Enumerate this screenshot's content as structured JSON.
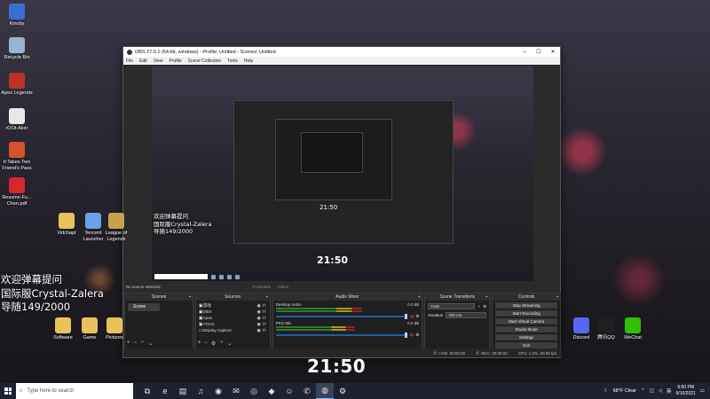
{
  "desktop": {
    "left_icons": [
      {
        "label": "Kinoby",
        "icon": "app-icon",
        "color": "#3a6fd0"
      },
      {
        "label": "Recycle Bin",
        "icon": "recycle-bin-icon",
        "color": "#9ab3cf"
      },
      {
        "label": "Apex Legends",
        "icon": "apex-icon",
        "color": "#c0302a"
      },
      {
        "label": "rOOt-Alotr",
        "icon": "file-icon",
        "color": "#e8e8e8"
      },
      {
        "label": "It Takes Two Friend's Pass",
        "icon": "game-icon",
        "color": "#d4542a"
      },
      {
        "label": "Resume-Fu... Chen.pdf",
        "icon": "pdf-icon",
        "color": "#d8262b"
      }
    ],
    "row_icons": [
      {
        "label": "Vidchapt",
        "icon": "folder-icon",
        "color": "#e8c25a"
      },
      {
        "label": "Tencent Launcher",
        "icon": "tencent-icon",
        "color": "#6aa2e8"
      },
      {
        "label": "League of Legends",
        "icon": "lol-icon",
        "color": "#c9a24a"
      }
    ],
    "bottom_icons": [
      {
        "label": "Software",
        "icon": "folder-icon",
        "color": "#e8c25a"
      },
      {
        "label": "Game",
        "icon": "folder-icon",
        "color": "#e8c25a"
      },
      {
        "label": "Pictures",
        "icon": "folder-icon",
        "color": "#e8c25a"
      }
    ],
    "right_icons": [
      {
        "label": "Discord",
        "icon": "discord-icon",
        "color": "#5865f2"
      },
      {
        "label": "腾讯QQ",
        "icon": "qq-icon",
        "color": "#1f1f1f"
      },
      {
        "label": "WeChat",
        "icon": "wechat-icon",
        "color": "#2dc100"
      }
    ],
    "overlay_lines": [
      "欢迎弹幕提问",
      "国际服Crystal-Zalera",
      "导随149/2000"
    ],
    "clock": "21:50"
  },
  "obs": {
    "title": "OBS 27.0.1 (64-bit, windows) - Profile: Untitled - Scenes: Untitled",
    "menu": [
      "File",
      "Edit",
      "View",
      "Profile",
      "Scene Collection",
      "Tools",
      "Help"
    ],
    "no_source": "No source selected",
    "properties_label": "Properties",
    "filters_label": "Filters",
    "docks": {
      "scenes": {
        "title": "Scenes",
        "items": [
          "Scene"
        ]
      },
      "sources": {
        "title": "Sources",
        "items": [
          "游戏",
          "OBS",
          "Apex",
          "YOUC",
          "Display Capture"
        ]
      },
      "mixer": {
        "title": "Audio Mixer",
        "channels": [
          {
            "name": "Desktop Audio",
            "db": "0.0 dB",
            "level": 0.6
          },
          {
            "name": "PKG Mic",
            "db": "0.0 dB",
            "level": 0.55
          }
        ]
      },
      "transitions": {
        "title": "Scene Transitions",
        "type": "Fade",
        "duration_label": "Duration",
        "duration": "300 ms"
      },
      "controls": {
        "title": "Controls",
        "buttons": [
          "Stop Streaming",
          "Start Recording",
          "Start Virtual Camera",
          "Studio Mode",
          "Settings",
          "Exit"
        ]
      }
    },
    "status": {
      "live": "LIVE: 00:00:00",
      "rec": "REC: 00:00:00",
      "cpu": "CPU: 1.2%, 60.00 fps"
    },
    "preview": {
      "clock": "21:50",
      "overlay_lines": [
        "欢迎弹幕提问",
        "国际服Crystal-Zalera",
        "导随149/2000"
      ]
    }
  },
  "taskbar": {
    "search_placeholder": "Type here to search",
    "apps": [
      {
        "icon": "task-view-icon",
        "glyph": "⧉"
      },
      {
        "icon": "edge-icon",
        "glyph": "e"
      },
      {
        "icon": "file-explorer-icon",
        "glyph": "▤"
      },
      {
        "icon": "netease-music-icon",
        "glyph": "♫"
      },
      {
        "icon": "red-app-icon",
        "glyph": "◉"
      },
      {
        "icon": "mail-icon",
        "glyph": "✉"
      },
      {
        "icon": "chrome-icon",
        "glyph": "◎"
      },
      {
        "icon": "qq-icon",
        "glyph": "◆"
      },
      {
        "icon": "discord-icon",
        "glyph": "☺"
      },
      {
        "icon": "wechat-icon",
        "glyph": "✆"
      },
      {
        "icon": "obs-icon",
        "glyph": "◍"
      },
      {
        "icon": "settings-icon",
        "glyph": "⚙"
      }
    ],
    "weather": "68°F  Clear",
    "time": "9:50 PM",
    "date": "9/10/2021"
  }
}
